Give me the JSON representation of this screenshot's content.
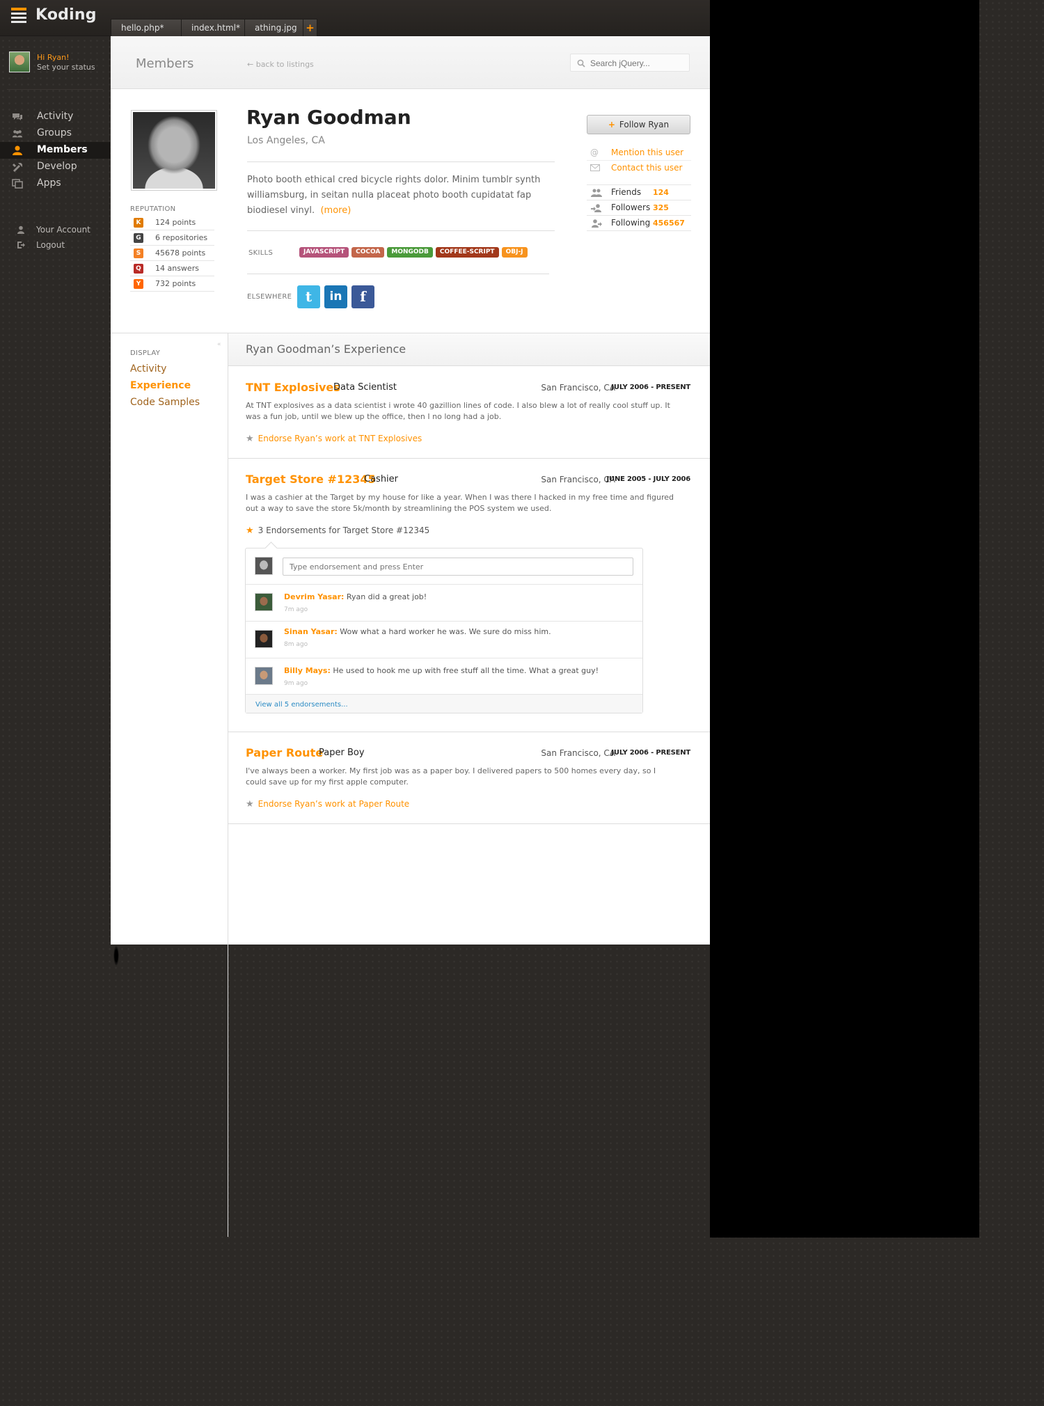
{
  "app": {
    "name": "Koding"
  },
  "tabs": [
    "hello.php*",
    "index.html*",
    "athing.jpg"
  ],
  "tab_add": "+",
  "user": {
    "greeting": "Hi Ryan!",
    "status": "Set your status"
  },
  "nav": [
    {
      "label": "Activity",
      "icon": "activity-icon"
    },
    {
      "label": "Groups",
      "icon": "groups-icon"
    },
    {
      "label": "Members",
      "icon": "members-icon",
      "active": true
    },
    {
      "label": "Develop",
      "icon": "develop-icon"
    },
    {
      "label": "Apps",
      "icon": "apps-icon"
    }
  ],
  "account": [
    {
      "label": "Your Account",
      "icon": "account-icon"
    },
    {
      "label": "Logout",
      "icon": "logout-icon"
    }
  ],
  "header": {
    "title": "Members",
    "back": "← back to listings",
    "search_placeholder": "Search jQuery..."
  },
  "profile": {
    "name": "Ryan Goodman",
    "location": "Los Angeles, CA",
    "bio": "Photo booth ethical cred bicycle rights dolor. Minim tumblr synth williamsburg, in seitan nulla placeat photo booth cupidatat fap biodiesel vinyl.",
    "bio_more": "(more)",
    "reputation_label": "REPUTATION",
    "reputation": [
      {
        "icon": "K",
        "color": "#e07b00",
        "label": "124 points"
      },
      {
        "icon": "G",
        "color": "#444444",
        "label": "6 repositories"
      },
      {
        "icon": "S",
        "color": "#f48024",
        "label": "45678 points"
      },
      {
        "icon": "Q",
        "color": "#b92b27",
        "label": "14 answers"
      },
      {
        "icon": "Y",
        "color": "#ff6600",
        "label": "732 points"
      }
    ],
    "skills_label": "SKILLS",
    "skills": [
      {
        "label": "JAVASCRIPT",
        "color": "#b5537a"
      },
      {
        "label": "COCOA",
        "color": "#c3664a"
      },
      {
        "label": "MONGODB",
        "color": "#4a9a3a"
      },
      {
        "label": "COFFEE-SCRIPT",
        "color": "#a2381a"
      },
      {
        "label": "OBJ-J",
        "color": "#f7931e"
      }
    ],
    "elsewhere_label": "ELSEWHERE",
    "social": [
      {
        "name": "twitter",
        "glyph": "t",
        "color": "#3fb6e6"
      },
      {
        "name": "linkedin",
        "glyph": "in",
        "color": "#1a76b5"
      },
      {
        "name": "facebook",
        "glyph": "f",
        "color": "#3b5998"
      }
    ]
  },
  "actions": {
    "follow": "Follow Ryan",
    "mention": "Mention this user",
    "contact": "Contact  this user"
  },
  "stats": [
    {
      "label": "Friends",
      "value": "124"
    },
    {
      "label": "Followers",
      "value": "325"
    },
    {
      "label": "Following",
      "value": "456567"
    }
  ],
  "display": {
    "label": "DISPLAY",
    "items": [
      "Activity",
      "Experience",
      "Code Samples"
    ],
    "active": "Experience"
  },
  "experience_title": "Ryan Goodman’s Experience",
  "experience": [
    {
      "company": "TNT Explosives",
      "role": "Data Scientist",
      "location": "San Francisco, CA",
      "dates": "JULY 2006 - PRESENT",
      "description": "At TNT explosives as a data scientist i wrote 40 gazillion lines of code. I also blew a lot of really cool stuff up. It was a fun job, until we blew up the office, then I no long had a job.",
      "endorse": "Endorse Ryan’s work at TNT Explosives"
    },
    {
      "company": "Target Store #12345",
      "role": "Cashier",
      "location": "San Francisco, CA",
      "dates": "JUNE 2005 - JULY 2006",
      "description": "I was a cashier at the Target by my house for like a year. When I was there I hacked in my free time and figured out a way to save the store 5k/month by streamlining the POS system we used.",
      "endorse": "3 Endorsements for Target Store #12345"
    },
    {
      "company": "Paper Route",
      "role": "Paper Boy",
      "location": "San Francisco, CA",
      "dates": "JULY 2006 - PRESENT",
      "description": "I've always been a worker. My first job was as a paper boy. I delivered papers to 500 homes every day, so I could save up for my first apple computer.",
      "endorse": "Endorse Ryan’s work at Paper Route"
    }
  ],
  "endorsements": {
    "input_placeholder": "Type endorsement and press Enter",
    "items": [
      {
        "name": "Devrim Yasar:",
        "text": " Ryan did a great job!",
        "time": "7m ago"
      },
      {
        "name": "Sinan Yasar:",
        "text": " Wow what a hard worker he was. We sure do miss him.",
        "time": "8m ago"
      },
      {
        "name": "Billy Mays:",
        "text": " He used to hook me up with free stuff all the time. What a great guy!",
        "time": "9m ago"
      }
    ],
    "view_all": "View all 5 endorsements..."
  }
}
